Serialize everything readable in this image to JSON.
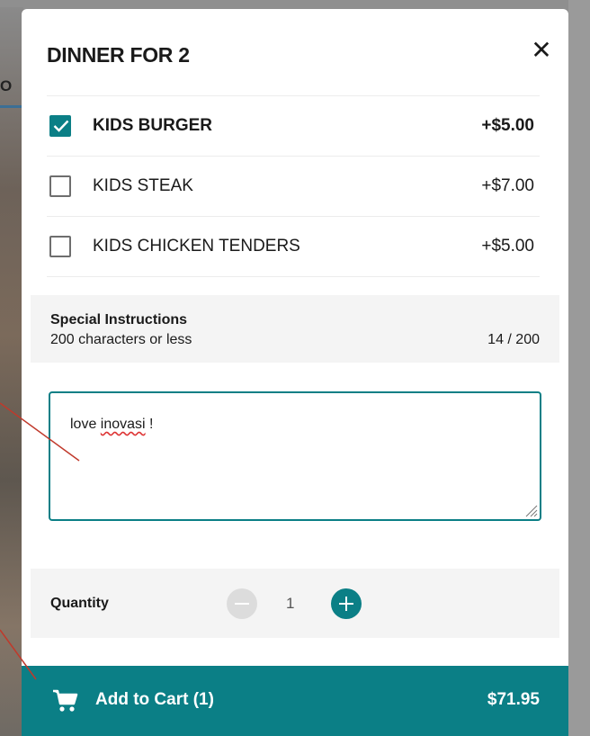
{
  "background": {
    "tab_text": "O"
  },
  "modal": {
    "title": "DINNER FOR 2",
    "close_glyph": "✕",
    "options": [
      {
        "label": "KIDS BURGER",
        "price": "+$5.00",
        "checked": true
      },
      {
        "label": "KIDS STEAK",
        "price": "+$7.00",
        "checked": false
      },
      {
        "label": "KIDS CHICKEN TENDERS",
        "price": "+$5.00",
        "checked": false
      }
    ],
    "instructions": {
      "title": "Special Instructions",
      "subtitle": "200 characters or less",
      "count": "14 / 200",
      "value_prefix": "love ",
      "value_misspelled": "inovasi",
      "value_suffix": " !"
    },
    "quantity": {
      "label": "Quantity",
      "value": "1"
    },
    "cart": {
      "label": "Add to Cart (1)",
      "total": "$71.95"
    }
  },
  "colors": {
    "accent": "#0b7f86",
    "annotation_line": "#c0392b"
  }
}
